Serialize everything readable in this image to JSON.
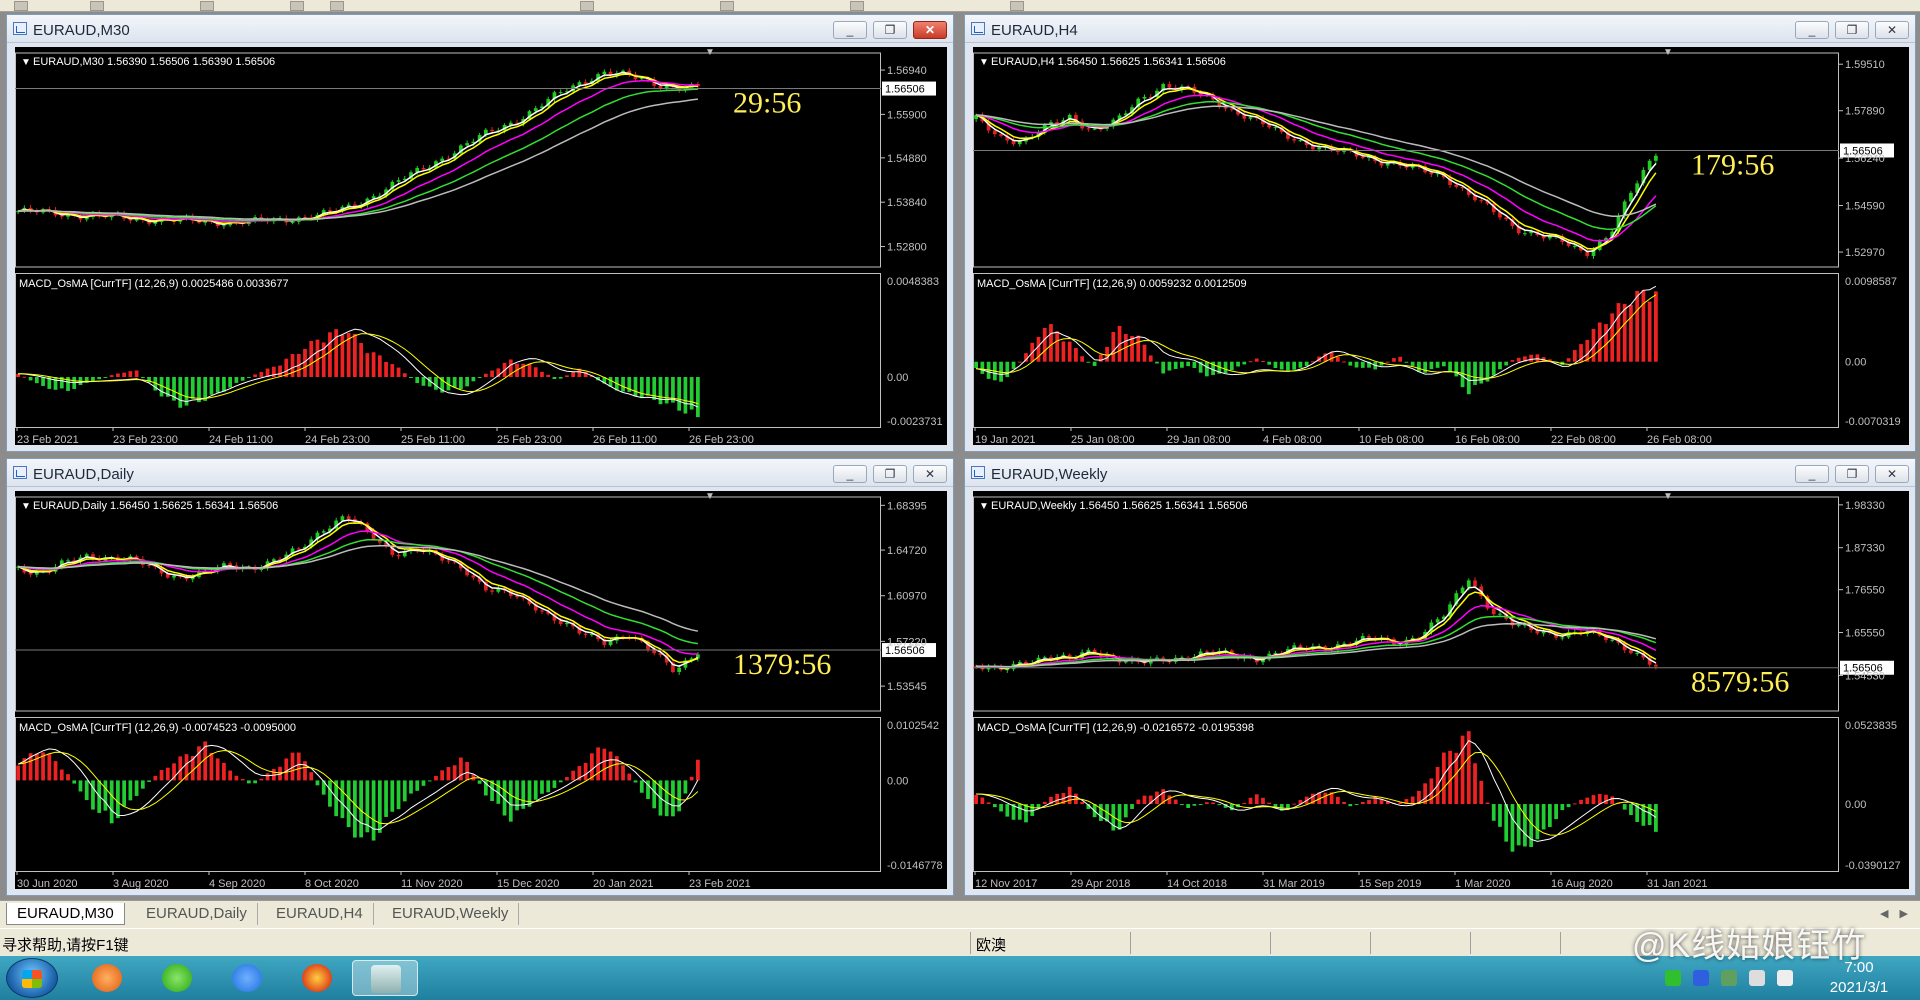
{
  "chart_windows": [
    {
      "title": "EURAUD,M30",
      "ohlc": "EURAUD,M30  1.56390 1.56506 1.56390 1.56506",
      "countdown": "29:56",
      "price_ticks": [
        "1.56940",
        "1.55900",
        "1.54880",
        "1.53840",
        "1.52800"
      ],
      "price_range": [
        1.5232,
        1.5734
      ],
      "current_price": "1.56506",
      "current_value": 1.56506,
      "indicator_label": "MACD_OsMA [CurrTF] (12,26,9) 0.0025486 0.0033677",
      "indicator_ticks": [
        "0.0048383",
        "0.00",
        "-0.0023731"
      ],
      "indicator_range": [
        -0.0025,
        0.0052
      ],
      "time_ticks": [
        "23 Feb 2021",
        "23 Feb 23:00",
        "24 Feb 11:00",
        "24 Feb 23:00",
        "25 Feb 11:00",
        "25 Feb 23:00",
        "26 Feb 11:00",
        "26 Feb 23:00"
      ],
      "price_path": [
        1.5363,
        1.536,
        1.5356,
        1.5352,
        1.5349,
        1.5345,
        1.5343,
        1.534,
        1.5339,
        1.5337,
        1.5338,
        1.5342,
        1.5348,
        1.5355,
        1.537,
        1.5395,
        1.5425,
        1.5455,
        1.5485,
        1.5515,
        1.5545,
        1.557,
        1.56,
        1.5635,
        1.5665,
        1.569,
        1.568,
        1.5665,
        1.5655,
        1.5651
      ],
      "osma_path": [
        0.0002,
        -0.0005,
        -0.0008,
        -0.0003,
        0.0001,
        0.0004,
        -0.0009,
        -0.0016,
        -0.0012,
        -0.0006,
        0.0001,
        0.0006,
        0.0014,
        0.0022,
        0.0026,
        0.0014,
        0.0007,
        -0.0003,
        -0.0008,
        -0.0006,
        0.0002,
        0.0009,
        0.0006,
        -0.0002,
        0.0005,
        -0.0004,
        -0.0009,
        -0.0012,
        -0.0016,
        -0.0022
      ]
    },
    {
      "title": "EURAUD,H4",
      "ohlc": "EURAUD,H4  1.56450 1.56625 1.56341 1.56506",
      "countdown": "179:56",
      "price_ticks": [
        "1.59510",
        "1.57890",
        "1.56240",
        "1.54590",
        "1.52970"
      ],
      "price_range": [
        1.5245,
        1.599
      ],
      "current_price": "1.56506",
      "current_value": 1.56506,
      "indicator_label": "MACD_OsMA [CurrTF] (12,26,9) 0.0059232 0.0012509",
      "indicator_ticks": [
        "0.0098587",
        "0.00",
        "-0.0070319"
      ],
      "indicator_range": [
        -0.0078,
        0.0106
      ],
      "time_ticks": [
        "19 Jan 2021",
        "25 Jan 08:00",
        "29 Jan 08:00",
        "4 Feb 08:00",
        "10 Feb 08:00",
        "16 Feb 08:00",
        "22 Feb 08:00",
        "26 Feb 08:00"
      ],
      "price_path": [
        1.576,
        1.57,
        1.568,
        1.573,
        1.577,
        1.572,
        1.575,
        1.583,
        1.588,
        1.586,
        1.583,
        1.579,
        1.575,
        1.571,
        1.568,
        1.565,
        1.564,
        1.562,
        1.56,
        1.558,
        1.556,
        1.55,
        1.544,
        1.538,
        1.536,
        1.533,
        1.529,
        1.536,
        1.551,
        1.564
      ],
      "osma_path": [
        -0.001,
        -0.003,
        0.0005,
        0.005,
        0.0025,
        -0.0008,
        0.0045,
        0.003,
        -0.0015,
        -0.0005,
        -0.002,
        -0.001,
        0.0005,
        -0.0012,
        -0.0008,
        0.0015,
        -0.0006,
        -0.001,
        0.0008,
        -0.0015,
        -0.0005,
        -0.004,
        -0.002,
        0.0005,
        0.001,
        -0.0005,
        0.003,
        0.006,
        0.0085,
        0.0092
      ]
    },
    {
      "title": "EURAUD,Daily",
      "ohlc": "EURAUD,Daily  1.56450 1.56625 1.56341 1.56506",
      "countdown": "1379:56",
      "price_ticks": [
        "1.68395",
        "1.64720",
        "1.60970",
        "1.57220",
        "1.53545"
      ],
      "price_range": [
        1.515,
        1.6908
      ],
      "current_price": "1.56506",
      "current_value": 1.56506,
      "indicator_label": "MACD_OsMA [CurrTF] (12,26,9) -0.0074523 -0.0095000",
      "indicator_ticks": [
        "0.0102542",
        "0.00",
        "-0.0146778"
      ],
      "indicator_range": [
        -0.016,
        0.0112
      ],
      "time_ticks": [
        "30 Jun 2020",
        "3 Aug 2020",
        "4 Sep 2020",
        "8 Oct 2020",
        "11 Nov 2020",
        "15 Dec 2020",
        "20 Jan 2021",
        "23 Feb 2021"
      ],
      "price_path": [
        1.633,
        1.628,
        1.636,
        1.643,
        1.641,
        1.638,
        1.63,
        1.625,
        1.628,
        1.635,
        1.633,
        1.638,
        1.648,
        1.665,
        1.675,
        1.66,
        1.645,
        1.648,
        1.64,
        1.633,
        1.615,
        1.61,
        1.602,
        1.59,
        1.578,
        1.572,
        1.579,
        1.564,
        1.548,
        1.565
      ],
      "osma_path": [
        0.0035,
        0.006,
        0.002,
        -0.0045,
        -0.008,
        -0.003,
        0.0015,
        0.0045,
        0.007,
        0.002,
        -0.001,
        0.0025,
        0.006,
        -0.003,
        -0.009,
        -0.012,
        -0.006,
        -0.002,
        0.0015,
        0.0045,
        -0.003,
        -0.0075,
        -0.004,
        -0.001,
        0.003,
        0.007,
        0.002,
        -0.005,
        -0.008,
        0.004
      ]
    },
    {
      "title": "EURAUD,Weekly",
      "ohlc": "EURAUD,Weekly  1.56450 1.56625 1.56341 1.56506",
      "countdown": "8579:56",
      "price_ticks": [
        "1.98330",
        "1.87330",
        "1.76550",
        "1.65550",
        "1.54530"
      ],
      "price_range": [
        1.454,
        2.0035
      ],
      "current_price": "1.56506",
      "current_value": 1.56506,
      "indicator_label": "MACD_OsMA [CurrTF] (12,26,9) -0.0216572 -0.0195398",
      "indicator_ticks": [
        "0.0523835",
        "0.00",
        "-0.0390127"
      ],
      "indicator_range": [
        -0.044,
        0.0572
      ],
      "time_ticks": [
        "12 Nov 2017",
        "29 Apr 2018",
        "14 Oct 2018",
        "31 Mar 2019",
        "15 Sep 2019",
        "1 Mar 2020",
        "16 Aug 2020",
        "31 Jan 2021"
      ],
      "price_path": [
        1.57,
        1.555,
        1.58,
        1.595,
        1.585,
        1.61,
        1.59,
        1.575,
        1.585,
        1.595,
        1.605,
        1.595,
        1.59,
        1.605,
        1.615,
        1.62,
        1.63,
        1.64,
        1.63,
        1.65,
        1.7,
        1.8,
        1.71,
        1.67,
        1.66,
        1.65,
        1.655,
        1.64,
        1.61,
        1.565
      ],
      "osma_path": [
        0.008,
        -0.005,
        -0.015,
        0.003,
        0.012,
        -0.008,
        -0.02,
        0.005,
        0.01,
        -0.003,
        0.002,
        -0.005,
        0.008,
        -0.006,
        0.005,
        0.01,
        -0.002,
        0.005,
        0.0,
        0.01,
        0.035,
        0.05,
        -0.01,
        -0.035,
        -0.025,
        -0.005,
        0.005,
        0.008,
        -0.01,
        -0.02
      ]
    }
  ],
  "tabs": [
    "EURAUD,M30",
    "EURAUD,Daily",
    "EURAUD,H4",
    "EURAUD,Weekly"
  ],
  "active_tab": 0,
  "status": {
    "help_text": "寻求帮助,请按F1键",
    "symbol_text": "欧澳"
  },
  "watermark": "@K线姑娘钰竹",
  "clock": {
    "time": "7:00",
    "date": "2021/3/1"
  },
  "colors": {
    "countdown": "#ffee55",
    "bull_candle": "#22cc22",
    "bear_candle": "#dd2222",
    "ma_yellow": "#ffff00",
    "ma_white": "#ffffff",
    "ma_magenta": "#ff00ff",
    "ma_green": "#33dd33",
    "ma_gray": "#bbbbbb",
    "osma_up": "#ee2222",
    "osma_down": "#22cc33",
    "axis": "#c0c0c0",
    "grid_line": "#7a7a7a"
  },
  "icons": {
    "window_minimize": "_",
    "window_restore": "❐",
    "window_close": "✕",
    "tab_scroll": "◀ ▶",
    "collapse_arrow": "▼"
  }
}
